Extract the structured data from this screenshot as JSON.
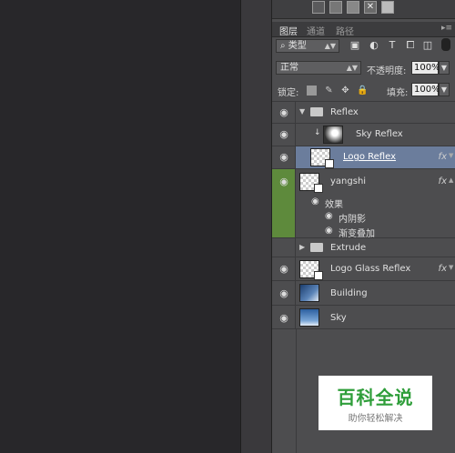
{
  "panel": {
    "tabs": [
      "图层",
      "通道",
      "路径"
    ],
    "active_tab": "图层",
    "filter": {
      "kind_label": "类型",
      "icons": [
        "image-filter-icon",
        "adjustment-filter-icon",
        "text-filter-icon",
        "shape-filter-icon",
        "smartobject-filter-icon"
      ]
    },
    "blend_mode": "正常",
    "opacity": {
      "label": "不透明度:",
      "value": "100%"
    },
    "lock": {
      "label": "锁定:",
      "icons": [
        "lock-pixels-icon",
        "lock-paint-icon",
        "lock-move-icon",
        "lock-all-icon"
      ]
    },
    "fill": {
      "label": "填充:",
      "value": "100%"
    },
    "fx_label": "fx",
    "layers": [
      {
        "name": "Reflex",
        "type": "group",
        "expanded": true,
        "icon": "folder-icon"
      },
      {
        "name": "Sky Reflex",
        "type": "clipped"
      },
      {
        "name": "Logo Reflex",
        "type": "smart",
        "selected": true,
        "fx": true
      },
      {
        "name": "yangshi",
        "type": "smart",
        "fx": true,
        "effects_label": "效果",
        "effects": [
          "内阴影",
          "渐变叠加"
        ]
      },
      {
        "name": "Extrude",
        "type": "group",
        "expanded": false,
        "icon": "folder-icon"
      },
      {
        "name": "Logo Glass Reflex",
        "type": "smart",
        "fx": true
      },
      {
        "name": "Building",
        "type": "image"
      },
      {
        "name": "Sky",
        "type": "image"
      }
    ]
  },
  "watermark": {
    "title": "百科全说",
    "subtitle": "助你轻松解决"
  },
  "colors": {
    "selected_row": "#6b7d9c",
    "green_tag": "#5e8a3c",
    "accent": "#2f9e3a"
  }
}
